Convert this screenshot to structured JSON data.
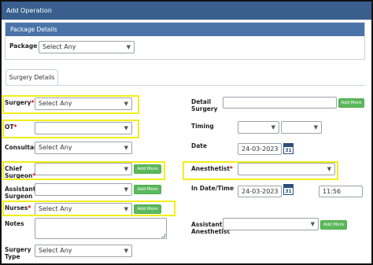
{
  "window": {
    "title": "Add Operation"
  },
  "package": {
    "header": "Package Details",
    "label": "Package",
    "select": "Select Any"
  },
  "tabs": [
    {
      "label": "Surgery Details"
    }
  ],
  "form": {
    "surgery": {
      "label": "Surgery",
      "value": "Select Any"
    },
    "ot": {
      "label": "OT",
      "value": ""
    },
    "consultant": {
      "label": "Consultant",
      "value": "Select Any"
    },
    "chief_surgeon": {
      "label": "Chief Surgeon",
      "value": "",
      "add": "Add More"
    },
    "assistant_surgeon": {
      "label": "Assistant Surgeon",
      "value": "",
      "add": "Add More"
    },
    "nurses": {
      "label": "Nurses",
      "value": "Select Any",
      "add": "Add More"
    },
    "notes": {
      "label": "Notes",
      "value": ""
    },
    "surgery_type": {
      "label": "Surgery Type",
      "value": "Select Any"
    },
    "detail_surgery": {
      "label": "Detail Surgery",
      "value": "",
      "add": "Add More"
    },
    "timing": {
      "label": "Timing",
      "value1": "",
      "value2": ""
    },
    "date": {
      "label": "Date",
      "value": "24-03-2023",
      "cal": "31"
    },
    "anesthetist": {
      "label": "Anesthetist",
      "value": ""
    },
    "in_datetime": {
      "label": "In Date/Time",
      "date": "24-03-2023",
      "cal": "31",
      "time": "11:56"
    },
    "assistant_anesthetist": {
      "label": "Assistant Anesthetist",
      "value": "",
      "add": "Add More"
    }
  },
  "required_marker": "*",
  "colors": {
    "titlebar": "#3a5f8f",
    "panel_head": "#4a73a8",
    "add_button": "#5cb85c",
    "highlight": "#f2ee1a"
  }
}
